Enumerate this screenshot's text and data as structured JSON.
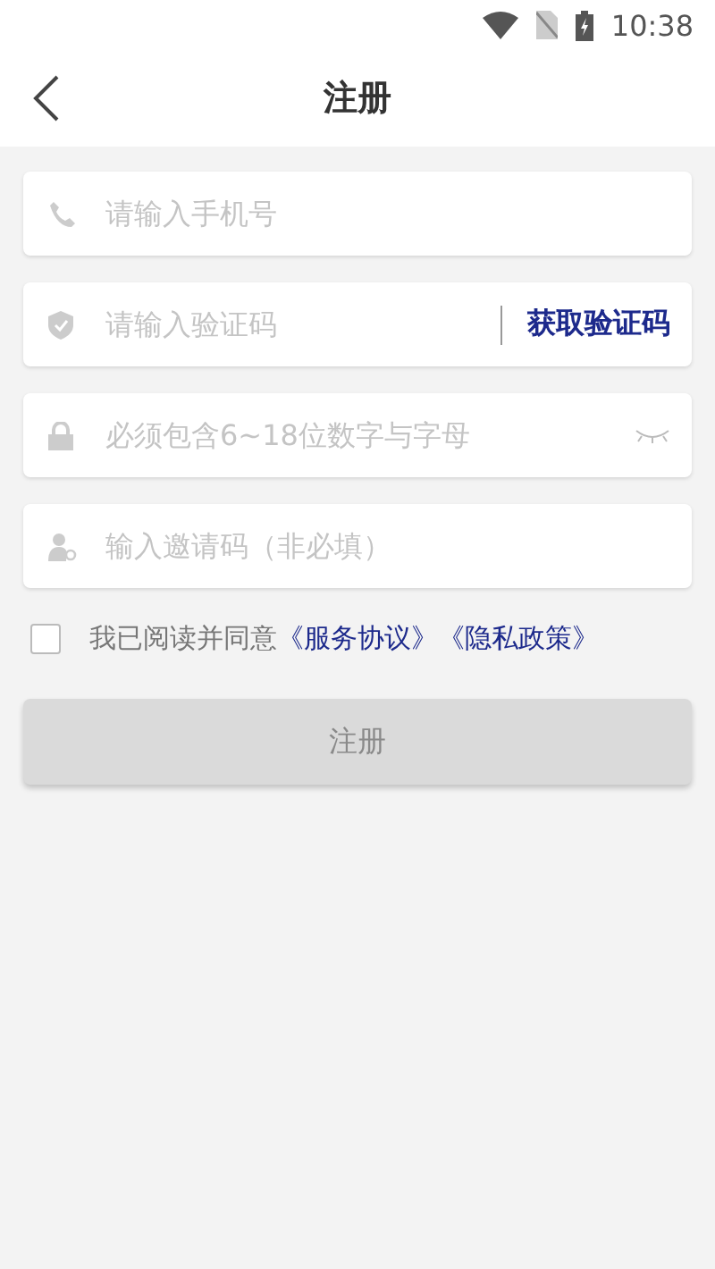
{
  "status_bar": {
    "time": "10:38"
  },
  "header": {
    "title": "注册"
  },
  "fields": [
    {
      "kind": "phone",
      "placeholder": "请输入手机号"
    },
    {
      "kind": "shield",
      "placeholder": "请输入验证码",
      "action": "获取验证码"
    },
    {
      "kind": "lock",
      "placeholder": "必须包含6~18位数字与字母",
      "password_hidden": true
    },
    {
      "kind": "user",
      "placeholder": "输入邀请码（非必填）"
    }
  ],
  "agreement": {
    "checked": false,
    "text": "我已阅读并同意",
    "links": [
      "《服务协议》",
      "《隐私政策》"
    ]
  },
  "submit": {
    "label": "注册",
    "disabled": true
  }
}
